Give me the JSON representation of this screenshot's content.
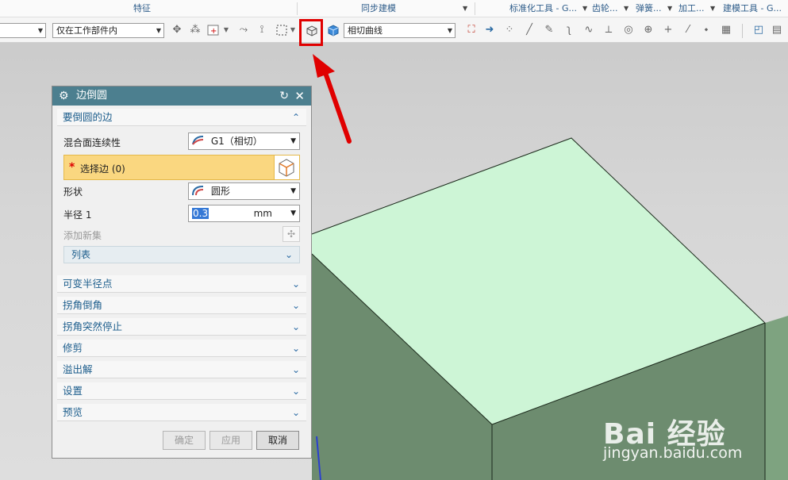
{
  "ribbon_groups": [
    {
      "label": "特征"
    },
    {
      "label": "同步建模"
    },
    {
      "label": "标准化工具 - G..."
    },
    {
      "label": "齿轮..."
    },
    {
      "label": "弹簧..."
    },
    {
      "label": "加工..."
    },
    {
      "label": "建模工具 - G..."
    }
  ],
  "toolbar": {
    "filter_combo": "",
    "scope_combo": "仅在工作部件内",
    "curve_rule_combo": "相切曲线"
  },
  "dialog": {
    "title": "边倒圆",
    "section_edges": "要倒圆的边",
    "continuity_label": "混合面连续性",
    "continuity_value": "G1（相切）",
    "select_edge_label": "选择边 (0)",
    "required_mark": "*",
    "shape_label": "形状",
    "shape_value": "圆形",
    "radius_label": "半径 1",
    "radius_value": "0.3",
    "radius_unit": "mm",
    "add_set_label": "添加新集",
    "list_label": "列表",
    "sections": [
      {
        "label": "可变半径点"
      },
      {
        "label": "拐角倒角"
      },
      {
        "label": "拐角突然停止"
      },
      {
        "label": "修剪"
      },
      {
        "label": "溢出解"
      },
      {
        "label": "设置"
      },
      {
        "label": "预览"
      }
    ],
    "ok_label": "确定",
    "apply_label": "应用",
    "cancel_label": "取消"
  },
  "watermark": {
    "brand": "Bai 经验",
    "url": "jingyan.baidu.com"
  },
  "colors": {
    "face_top": "#cdf5d6",
    "face_front": "#6d8c6f",
    "face_right": "#7ea380",
    "dialog_title": "#4c7f8f",
    "highlight": "#e00000",
    "select_row": "#fad780"
  }
}
